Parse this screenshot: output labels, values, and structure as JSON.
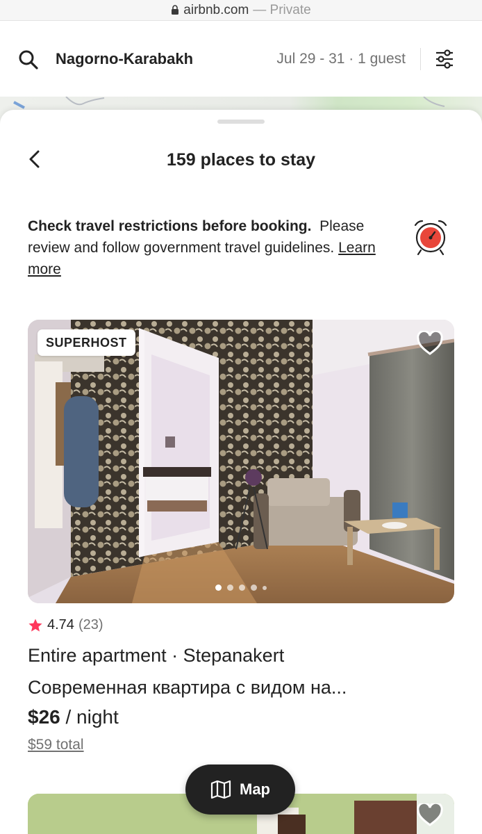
{
  "browser": {
    "domain": "airbnb.com",
    "private_label": "— Private"
  },
  "search": {
    "location": "Nagorno-Karabakh",
    "dates_guests": "Jul 29 - 31 · 1 guest"
  },
  "sheet": {
    "title": "159 places to stay"
  },
  "notice": {
    "bold_text": "Check travel restrictions before booking.",
    "body_text": "Please review and follow government travel guidelines.",
    "link_text": "Learn more"
  },
  "listing": {
    "badge": "SUPERHOST",
    "rating": "4.74",
    "reviews": "(23)",
    "type_location": "Entire apartment · Stepanakert",
    "name": "Современная квартира с видом на...",
    "price": "$26",
    "price_unit": "/ night",
    "total": "$59 total",
    "photo_count": 5,
    "active_photo_index": 0
  },
  "map_button": {
    "label": "Map"
  },
  "colors": {
    "accent": "#FF385C",
    "text": "#222222",
    "muted": "#717171",
    "alarm_red": "#E8463A"
  }
}
